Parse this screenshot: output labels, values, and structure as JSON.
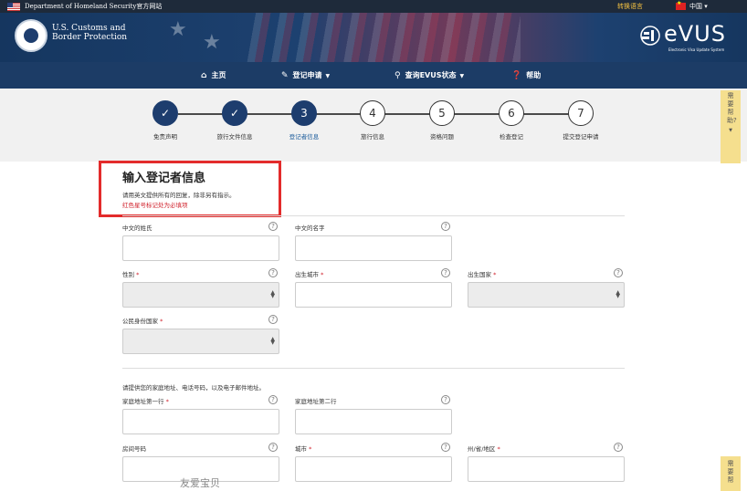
{
  "topbar": {
    "dhs_text": "Department of Homeland Security官方网站",
    "language_toggle": "转换语言",
    "language_current": "中国",
    "caret": "▾"
  },
  "header": {
    "agency_line1": "U.S. Customs and",
    "agency_line2": "Border Protection",
    "logo_word": "eVUS",
    "logo_subtitle": "Electronic Visa Update System"
  },
  "nav": {
    "items": [
      {
        "icon": "home-icon",
        "label": "主页",
        "dropdown": false
      },
      {
        "icon": "edit-icon",
        "label": "登记申请",
        "dropdown": true
      },
      {
        "icon": "search-icon",
        "label": "查询EVUS状态",
        "dropdown": true
      },
      {
        "icon": "question-icon",
        "label": "帮助",
        "dropdown": false
      }
    ]
  },
  "steps": [
    {
      "mark": "✓",
      "label": "免责声明",
      "state": "done"
    },
    {
      "mark": "✓",
      "label": "旅行文件信息",
      "state": "done"
    },
    {
      "mark": "3",
      "label": "登记者信息",
      "state": "current"
    },
    {
      "mark": "4",
      "label": "旅行信息",
      "state": "todo"
    },
    {
      "mark": "5",
      "label": "资格问题",
      "state": "todo"
    },
    {
      "mark": "6",
      "label": "检查登记",
      "state": "todo"
    },
    {
      "mark": "7",
      "label": "提交登记申请",
      "state": "todo"
    }
  ],
  "help_tab": {
    "text_top": "需要帮助?",
    "text_bottom": "需要帮"
  },
  "form": {
    "title": "输入登记者信息",
    "note": "请用英文提供所有的回复，除非另有指示。",
    "required_note": "红色星号标记处为必填项",
    "help_mark": "?",
    "required_mark": "*",
    "fields": {
      "surname_cn": "中文的姓氏",
      "given_name_cn": "中文的名字",
      "gender": "性别",
      "birth_city": "出生城市",
      "birth_country": "出生国家",
      "citizenship_country": "公民身份国家",
      "address_intro": "请提供您的家庭地址、电话号码，以及电子邮件地址。",
      "address_line1": "家庭地址第一行",
      "address_line2": "家庭地址第二行",
      "apartment_number": "房间号码",
      "city": "城市",
      "state_province": "州/省/地区"
    }
  },
  "watermark": "友爱宝贝",
  "colors": {
    "navy": "#1d3d6e",
    "required_red": "#d0212b",
    "highlight_red": "#e32b2b",
    "help_tab": "#f5df8e"
  }
}
